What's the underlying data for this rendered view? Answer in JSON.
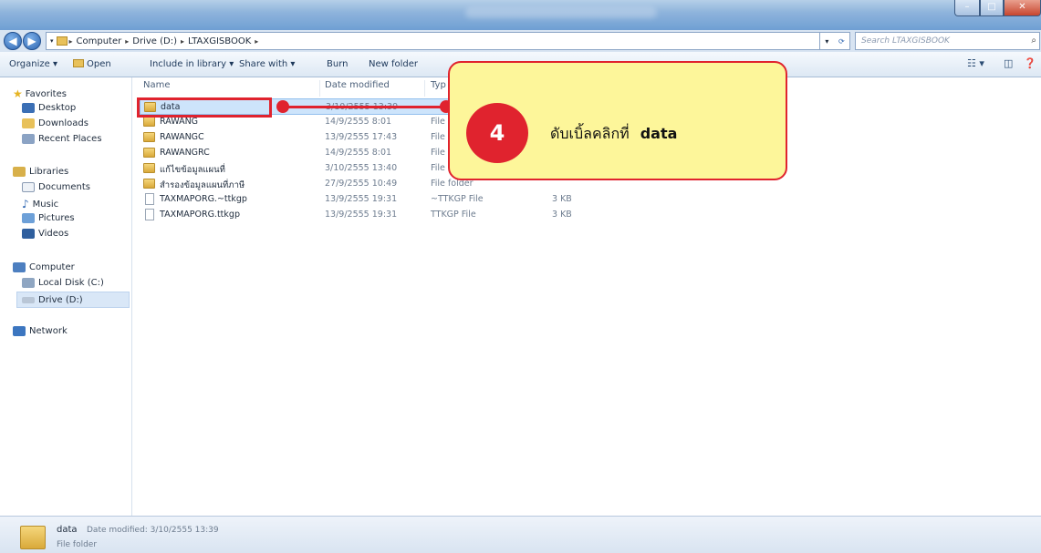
{
  "address": {
    "crumbs": [
      "Computer",
      "Drive (D:)",
      "LTAXGISBOOK"
    ],
    "search_placeholder": "Search LTAXGISBOOK"
  },
  "toolbar": {
    "organize": "Organize ▾",
    "open": "Open",
    "include_in_library": "Include in library ▾",
    "share_with": "Share with ▾",
    "burn": "Burn",
    "new_folder": "New folder"
  },
  "nav": {
    "favorites": "Favorites",
    "desktop": "Desktop",
    "downloads": "Downloads",
    "recent_places": "Recent Places",
    "libraries": "Libraries",
    "documents": "Documents",
    "music": "Music",
    "pictures": "Pictures",
    "videos": "Videos",
    "computer": "Computer",
    "local_disk": "Local Disk (C:)",
    "drive_d": "Drive (D:)",
    "network": "Network"
  },
  "columns": {
    "name": "Name",
    "date_modified": "Date modified",
    "type": "Typ",
    "size": ""
  },
  "files": [
    {
      "name": "data",
      "date": "3/10/2555 13:39",
      "type": "",
      "size": "",
      "kind": "folder"
    },
    {
      "name": "RAWANG",
      "date": "14/9/2555 8:01",
      "type": "File",
      "size": "",
      "kind": "folder"
    },
    {
      "name": "RAWANGC",
      "date": "13/9/2555 17:43",
      "type": "File",
      "size": "",
      "kind": "folder"
    },
    {
      "name": "RAWANGRC",
      "date": "14/9/2555 8:01",
      "type": "File folder",
      "size": "",
      "kind": "folder"
    },
    {
      "name": "แก้ไขข้อมูลแผนที่",
      "date": "3/10/2555 13:40",
      "type": "File folder",
      "size": "",
      "kind": "folder"
    },
    {
      "name": "สำรองข้อมูลแผนที่ภาษี",
      "date": "27/9/2555 10:49",
      "type": "File folder",
      "size": "",
      "kind": "folder"
    },
    {
      "name": "TAXMAPORG.~ttkgp",
      "date": "13/9/2555 19:31",
      "type": "~TTKGP File",
      "size": "3 KB",
      "kind": "file"
    },
    {
      "name": "TAXMAPORG.ttkgp",
      "date": "13/9/2555 19:31",
      "type": "TTKGP File",
      "size": "3 KB",
      "kind": "file"
    }
  ],
  "callout": {
    "step": "4",
    "instruction": "ดับเบิ้ลคลิกที่",
    "target": "data"
  },
  "status": {
    "name": "data",
    "date_label": "Date modified: 3/10/2555 13:39",
    "type": "File folder"
  },
  "colors": {
    "accent_red": "#e0232e",
    "callout_fill": "#fdf69a",
    "selection": "#cde4fb"
  }
}
